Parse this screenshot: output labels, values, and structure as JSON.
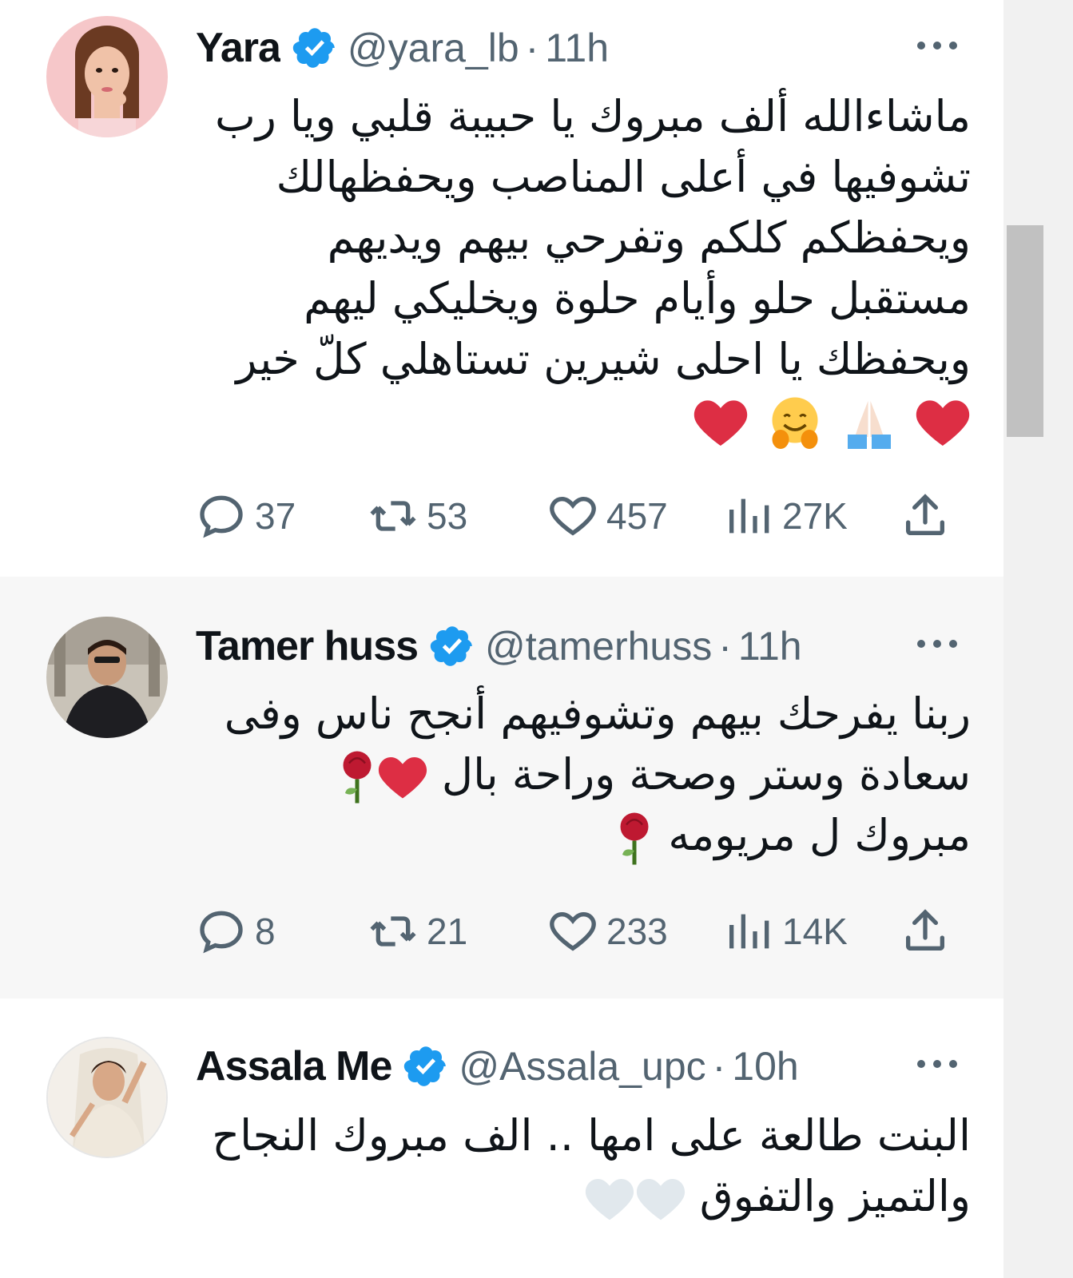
{
  "colors": {
    "verified": "#1d9bf0",
    "meta_text": "#536471",
    "body_text": "#0f1419",
    "heart": "#e0245e"
  },
  "tweets": [
    {
      "name": "Yara",
      "handle": "@yara_lb",
      "separator": "·",
      "time": "11h",
      "lines": [
        "ماشاءالله ألف مبروك يا حبيبة قلبي ويا رب",
        "تشوفيها في أعلى المناصب ويحفظهالك",
        "ويحفظكم كلكم وتفرحي بيهم ويديهم",
        "مستقبل حلو وأيام حلوة ويخليكي ليهم",
        "ويحفظك يا احلى شيرين تستاهلي كلّ خير"
      ],
      "emojis": [
        "red-heart",
        "folded-hands",
        "hugging-face",
        "red-heart"
      ],
      "replies": "37",
      "reposts": "53",
      "likes": "457",
      "views": "27K"
    },
    {
      "name": "Tamer huss",
      "handle": "@tamerhuss",
      "separator": "·",
      "time": "11h",
      "lines": [
        "ربنا يفرحك بيهم وتشوفيهم أنجح ناس وفى",
        "سعادة وستر وصحة وراحة بال",
        "مبروك ل مريومه"
      ],
      "emojis_line2": [
        "red-heart",
        "rose"
      ],
      "emojis_line3": [
        "rose"
      ],
      "replies": "8",
      "reposts": "21",
      "likes": "233",
      "views": "14K"
    },
    {
      "name": "Assala Me",
      "handle": "@Assala_upc",
      "separator": "·",
      "time": "10h",
      "lines": [
        "البنت طالعة على امها .. الف مبروك النجاح",
        "والتميز والتفوق"
      ],
      "emojis_line2": [
        "white-heart",
        "white-heart"
      ]
    }
  ]
}
